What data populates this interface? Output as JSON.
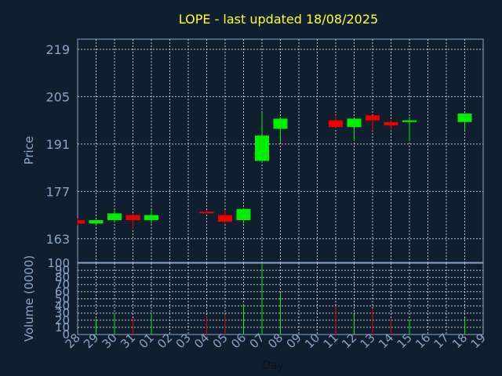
{
  "chart_data": {
    "type": "candlestick",
    "title": "LOPE - last updated 18/08/2025",
    "xlabel": "Day",
    "price_ylabel": "Price",
    "volume_ylabel": "Volume (0000)",
    "x_ticks": [
      "28",
      "29",
      "30",
      "31",
      "01",
      "02",
      "03",
      "04",
      "05",
      "06",
      "07",
      "08",
      "09",
      "10",
      "11",
      "12",
      "13",
      "14",
      "15",
      "16",
      "17",
      "18",
      "19"
    ],
    "price_ticks": [
      163,
      177,
      191,
      205,
      219
    ],
    "price_ylim": [
      156,
      222
    ],
    "volume_ticks": [
      0,
      10,
      20,
      30,
      40,
      50,
      60,
      70,
      80,
      90,
      100
    ],
    "volume_ylim": [
      0,
      100
    ],
    "up_color": "#00ee00",
    "down_color": "#ee0000",
    "background": "#0f1f30",
    "grid": true,
    "candles": [
      {
        "day": "28",
        "open": 168.5,
        "high": 169.0,
        "low": 167.0,
        "close": 167.5,
        "volume": 0
      },
      {
        "day": "29",
        "open": 167.5,
        "high": 168.5,
        "low": 167.0,
        "close": 168.5,
        "volume": 22
      },
      {
        "day": "30",
        "open": 168.5,
        "high": 171.5,
        "low": 168.0,
        "close": 170.5,
        "volume": 30
      },
      {
        "day": "31",
        "open": 170.0,
        "high": 170.5,
        "low": 166.0,
        "close": 168.5,
        "volume": 23
      },
      {
        "day": "01",
        "open": 168.5,
        "high": 171.5,
        "low": 167.5,
        "close": 170.0,
        "volume": 30
      },
      {
        "day": "04",
        "open": 171.0,
        "high": 171.5,
        "low": 170.5,
        "close": 170.5,
        "volume": 25
      },
      {
        "day": "05",
        "open": 170.0,
        "high": 171.5,
        "low": 167.5,
        "close": 168.0,
        "volume": 28
      },
      {
        "day": "06",
        "open": 168.5,
        "high": 171.8,
        "low": 167.5,
        "close": 171.8,
        "volume": 43
      },
      {
        "day": "07",
        "open": 186.0,
        "high": 200.5,
        "low": 185.5,
        "close": 193.5,
        "volume": 100
      },
      {
        "day": "08",
        "open": 195.5,
        "high": 199.0,
        "low": 191.5,
        "close": 198.5,
        "volume": 58
      },
      {
        "day": "11",
        "open": 198.0,
        "high": 199.5,
        "low": 195.5,
        "close": 196.0,
        "volume": 40
      },
      {
        "day": "12",
        "open": 196.0,
        "high": 198.5,
        "low": 192.0,
        "close": 198.5,
        "volume": 28
      },
      {
        "day": "13",
        "open": 199.5,
        "high": 199.5,
        "low": 195.0,
        "close": 198.0,
        "volume": 35
      },
      {
        "day": "14",
        "open": 197.5,
        "high": 198.0,
        "low": 195.0,
        "close": 196.5,
        "volume": 22
      },
      {
        "day": "15",
        "open": 197.5,
        "high": 199.0,
        "low": 192.0,
        "close": 198.0,
        "volume": 20
      },
      {
        "day": "18",
        "open": 197.5,
        "high": 200.0,
        "low": 195.0,
        "close": 200.0,
        "volume": 23
      }
    ]
  }
}
